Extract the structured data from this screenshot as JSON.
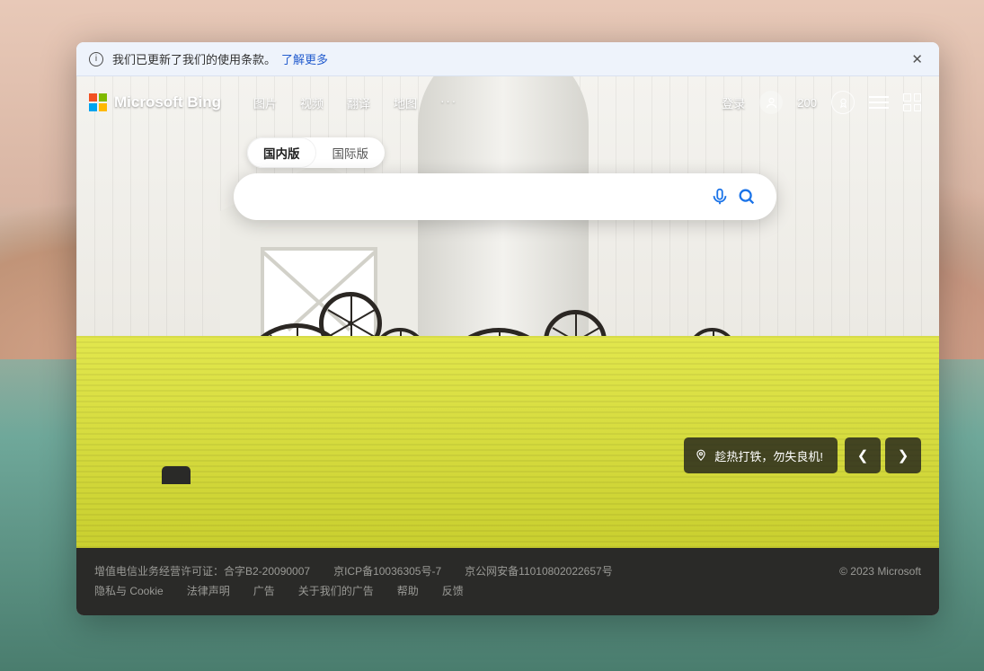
{
  "notice": {
    "text": "我们已更新了我们的使用条款。",
    "link": "了解更多"
  },
  "logo_text": "Microsoft Bing",
  "nav": [
    "图片",
    "视频",
    "翻译",
    "地图"
  ],
  "nav_more": "···",
  "signin": "登录",
  "rewards_points": "200",
  "scope": {
    "domestic": "国内版",
    "intl": "国际版"
  },
  "search": {
    "value": "",
    "placeholder": ""
  },
  "caption": "趁热打铁，勿失良机!",
  "footer": {
    "line1": [
      "增值电信业务经营许可证：合字B2-20090007",
      "京ICP备10036305号-7",
      "京公网安备11010802022657号"
    ],
    "copyright": "© 2023 Microsoft",
    "line2": [
      "隐私与 Cookie",
      "法律声明",
      "广告",
      "关于我们的广告",
      "帮助",
      "反馈"
    ]
  }
}
